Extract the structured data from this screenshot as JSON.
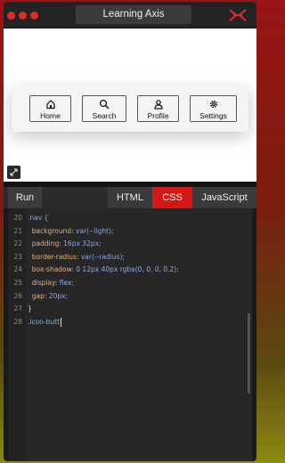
{
  "app": {
    "title": "Learning Axis",
    "accent": "#e32a2a"
  },
  "preview": {
    "nav_items": [
      {
        "label": "Home",
        "icon": "home-icon"
      },
      {
        "label": "Search",
        "icon": "search-icon"
      },
      {
        "label": "Profile",
        "icon": "user-icon"
      },
      {
        "label": "Settings",
        "icon": "gear-icon"
      }
    ]
  },
  "editor": {
    "run_label": "Run",
    "tabs": [
      "HTML",
      "CSS",
      "JavaScript"
    ],
    "active_tab": "CSS",
    "lines": [
      {
        "n": "20",
        "parts": [
          [
            "sel",
            ".nav {"
          ]
        ]
      },
      {
        "n": "21",
        "parts": [
          [
            "prop",
            "  background: "
          ],
          [
            "val",
            "var(--light);"
          ]
        ]
      },
      {
        "n": "22",
        "parts": [
          [
            "prop",
            "  padding: "
          ],
          [
            "val",
            "16px 32px;"
          ]
        ]
      },
      {
        "n": "23",
        "parts": [
          [
            "prop",
            "  border-radius: "
          ],
          [
            "val",
            "var(--radius);"
          ]
        ]
      },
      {
        "n": "24",
        "parts": [
          [
            "prop",
            "  box-shadow: "
          ],
          [
            "val",
            "0 12px 40px rgba(0, 0, 0, 0.2);"
          ]
        ]
      },
      {
        "n": "25",
        "parts": [
          [
            "prop",
            "  display: "
          ],
          [
            "val",
            "flex;"
          ]
        ]
      },
      {
        "n": "26",
        "parts": [
          [
            "prop",
            "  gap: "
          ],
          [
            "val",
            "20px;"
          ]
        ]
      },
      {
        "n": "27",
        "parts": [
          [
            "plain",
            "}"
          ]
        ]
      },
      {
        "n": "28",
        "parts": [
          [
            "sel",
            ".icon-butt"
          ]
        ]
      }
    ]
  }
}
